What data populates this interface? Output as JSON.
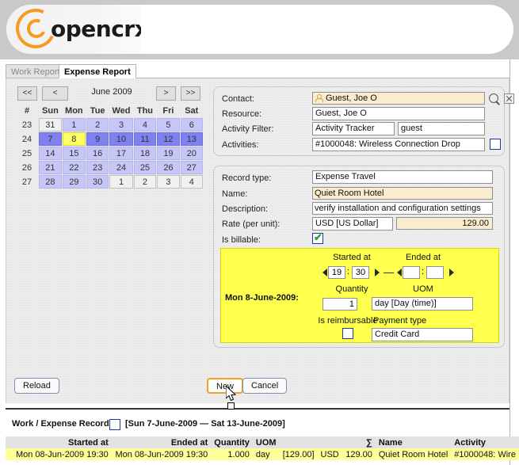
{
  "app": {
    "logo_text": "opencrx",
    "logo_color": "#f79a1f"
  },
  "tabs": [
    {
      "label": "Work Report",
      "active": false
    },
    {
      "label": "Expense Report",
      "active": true
    }
  ],
  "calendar": {
    "title": "June 2009",
    "nav": {
      "first": "<<",
      "prev": "<",
      "next": ">",
      "last": ">>"
    },
    "headers": [
      "#",
      "Sun",
      "Mon",
      "Tue",
      "Wed",
      "Thu",
      "Fri",
      "Sat"
    ],
    "weeks": [
      {
        "week": "23",
        "days": [
          {
            "n": "31",
            "state": "out"
          },
          {
            "n": "1",
            "state": "norm"
          },
          {
            "n": "2",
            "state": "norm"
          },
          {
            "n": "3",
            "state": "norm"
          },
          {
            "n": "4",
            "state": "norm"
          },
          {
            "n": "5",
            "state": "norm"
          },
          {
            "n": "6",
            "state": "norm"
          }
        ]
      },
      {
        "week": "24",
        "days": [
          {
            "n": "7",
            "state": "week"
          },
          {
            "n": "8",
            "state": "sel"
          },
          {
            "n": "9",
            "state": "week"
          },
          {
            "n": "10",
            "state": "week"
          },
          {
            "n": "11",
            "state": "week"
          },
          {
            "n": "12",
            "state": "week"
          },
          {
            "n": "13",
            "state": "week"
          }
        ]
      },
      {
        "week": "25",
        "days": [
          {
            "n": "14",
            "state": "norm"
          },
          {
            "n": "15",
            "state": "norm"
          },
          {
            "n": "16",
            "state": "norm"
          },
          {
            "n": "17",
            "state": "norm"
          },
          {
            "n": "18",
            "state": "norm"
          },
          {
            "n": "19",
            "state": "norm"
          },
          {
            "n": "20",
            "state": "norm"
          }
        ]
      },
      {
        "week": "26",
        "days": [
          {
            "n": "21",
            "state": "norm"
          },
          {
            "n": "22",
            "state": "norm"
          },
          {
            "n": "23",
            "state": "norm"
          },
          {
            "n": "24",
            "state": "norm"
          },
          {
            "n": "25",
            "state": "norm"
          },
          {
            "n": "26",
            "state": "norm"
          },
          {
            "n": "27",
            "state": "norm"
          }
        ]
      },
      {
        "week": "27",
        "days": [
          {
            "n": "28",
            "state": "norm"
          },
          {
            "n": "29",
            "state": "norm"
          },
          {
            "n": "30",
            "state": "norm"
          },
          {
            "n": "1",
            "state": "out"
          },
          {
            "n": "2",
            "state": "out"
          },
          {
            "n": "3",
            "state": "out"
          },
          {
            "n": "4",
            "state": "out"
          }
        ]
      }
    ]
  },
  "form_top": {
    "contact_label": "Contact:",
    "contact_value": "Guest, Joe O",
    "resource_label": "Resource:",
    "resource_value": "Guest, Joe O",
    "activity_filter_label": "Activity Filter:",
    "activity_filter_type": "Activity Tracker",
    "activity_filter_value": "guest",
    "activities_label": "Activities:",
    "activities_value": "#1000048: Wireless Connection Drop"
  },
  "form_record": {
    "record_type_label": "Record type:",
    "record_type_value": "Expense Travel",
    "name_label": "Name:",
    "name_value": "Quiet Room Hotel",
    "description_label": "Description:",
    "description_value": "verify installation and configuration settings",
    "rate_label": "Rate (per unit):",
    "rate_currency": "USD [US Dollar]",
    "rate_amount": "129.00",
    "is_billable_label": "Is billable:",
    "is_billable_checked": true
  },
  "time_panel": {
    "day_label": "Mon 8-June-2009:",
    "started_at_caption": "Started at",
    "ended_at_caption": "Ended at",
    "started_hour": "19",
    "started_minute": "30",
    "ended_hour": "",
    "ended_minute": "",
    "separator": "—",
    "quantity_caption": "Quantity",
    "quantity_value": "1",
    "uom_caption": "UOM",
    "uom_value": "day [Day (time)]",
    "is_reimbursable_caption": "Is reimbursable",
    "is_reimbursable_checked": false,
    "payment_type_caption": "Payment type",
    "payment_type_value": "Credit Card"
  },
  "buttons": {
    "reload": "Reload",
    "new": "New",
    "cancel": "Cancel"
  },
  "record_section": {
    "label": "Work / Expense Record",
    "checked": false,
    "range": "[Sun 7-June-2009 — Sat 13-June-2009]",
    "columns": [
      "",
      "Started at",
      "Ended at",
      "Quantity",
      "UOM",
      "",
      "",
      "∑",
      "Name",
      "Activity"
    ],
    "rows": [
      {
        "blank": "",
        "started_at": "Mon 08-Jun-2009 19:30",
        "ended_at": "Mon 08-Jun-2009 19:30",
        "quantity": "1.000",
        "uom": "day",
        "rate": "[129.00]",
        "currency": "USD",
        "sum": "129.00",
        "name": "Quiet Room Hotel",
        "activity": "#1000048: Wire"
      }
    ]
  }
}
